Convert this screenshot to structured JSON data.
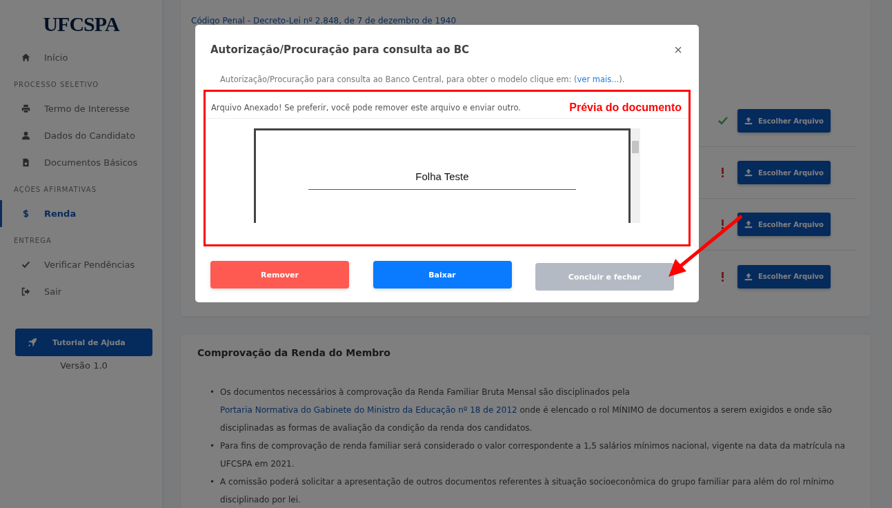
{
  "sidebar": {
    "logo": "UFCSPA",
    "sections": [
      {
        "items": [
          {
            "label": "Início",
            "selected": false
          }
        ]
      },
      {
        "heading": "PROCESSO SELETIVO",
        "items": [
          {
            "label": "Termo de Interesse",
            "selected": false
          },
          {
            "label": "Dados do Candidato",
            "selected": false
          },
          {
            "label": "Documentos Básicos",
            "selected": false
          }
        ]
      },
      {
        "heading": "AÇÕES AFIRMATIVAS",
        "items": [
          {
            "label": "Renda",
            "selected": true
          }
        ]
      },
      {
        "heading": "ENTREGA",
        "items": [
          {
            "label": "Verificar Pendências",
            "selected": false
          },
          {
            "label": "Sair",
            "selected": false
          }
        ]
      }
    ],
    "help_button": "Tutorial de Ajuda",
    "version": "Versão 1.0"
  },
  "main": {
    "legal_link": "Código Penal - Decreto-Lei nº 2.848, de 7 de dezembro de 1940",
    "upload_rows": [
      {
        "complete": true,
        "button": "Escolher Arquivo"
      },
      {
        "complete": false,
        "button": "Escolher Arquivo"
      },
      {
        "complete": false,
        "button": "Escolher Arquivo"
      },
      {
        "complete": false,
        "button": "Escolher Arquivo"
      }
    ],
    "section": {
      "title": "Comprovação da Renda do Membro",
      "bullets": [
        {
          "marker": "•",
          "text": "Os documentos necessários à comprovação da Renda Familiar Bruta Mensal são disciplinados pela ",
          "link": "Portaria Normativa do Gabinete do Ministro da Educação nº 18 de 2012",
          "after": " onde é elencado o rol MÍNIMO de documentos a serem exigidos e onde são disciplinadas as formas de avaliação da condição da renda dos candidatos."
        },
        {
          "marker": "•",
          "text": "Para fins de comprovação de renda familiar será considerado o valor correspondente a 1,5 salários mínimos nacional, vigente na data da matrícula na UFCSPA em 2021."
        },
        {
          "marker": "•",
          "text": "A comissão poderá solicitar a apresentação de outros documentos referentes à situação socioeconômica do grupo familiar para além do rol mínimo disciplinado por lei."
        }
      ]
    }
  },
  "modal": {
    "title": "Autorização/Procuração para consulta ao BC",
    "close": "×",
    "intro": "Autorização/Procuração para consulta ao Banco Central, para obter o modelo clique em: (",
    "intro_link": "ver mais...",
    "intro_end": ").",
    "notice": "Arquivo Anexado! Se preferir, você pode remover este arquivo e enviar outro.",
    "preview": {
      "heading": "Folha Teste"
    },
    "buttons": [
      {
        "label": "Remover",
        "kind": "danger",
        "disabled": false
      },
      {
        "label": "Baixar",
        "kind": "primary",
        "disabled": false
      },
      {
        "label": "Concluir e fechar",
        "kind": "secondary",
        "disabled": true
      }
    ]
  },
  "annotation": {
    "label": "Prévia do documento"
  }
}
